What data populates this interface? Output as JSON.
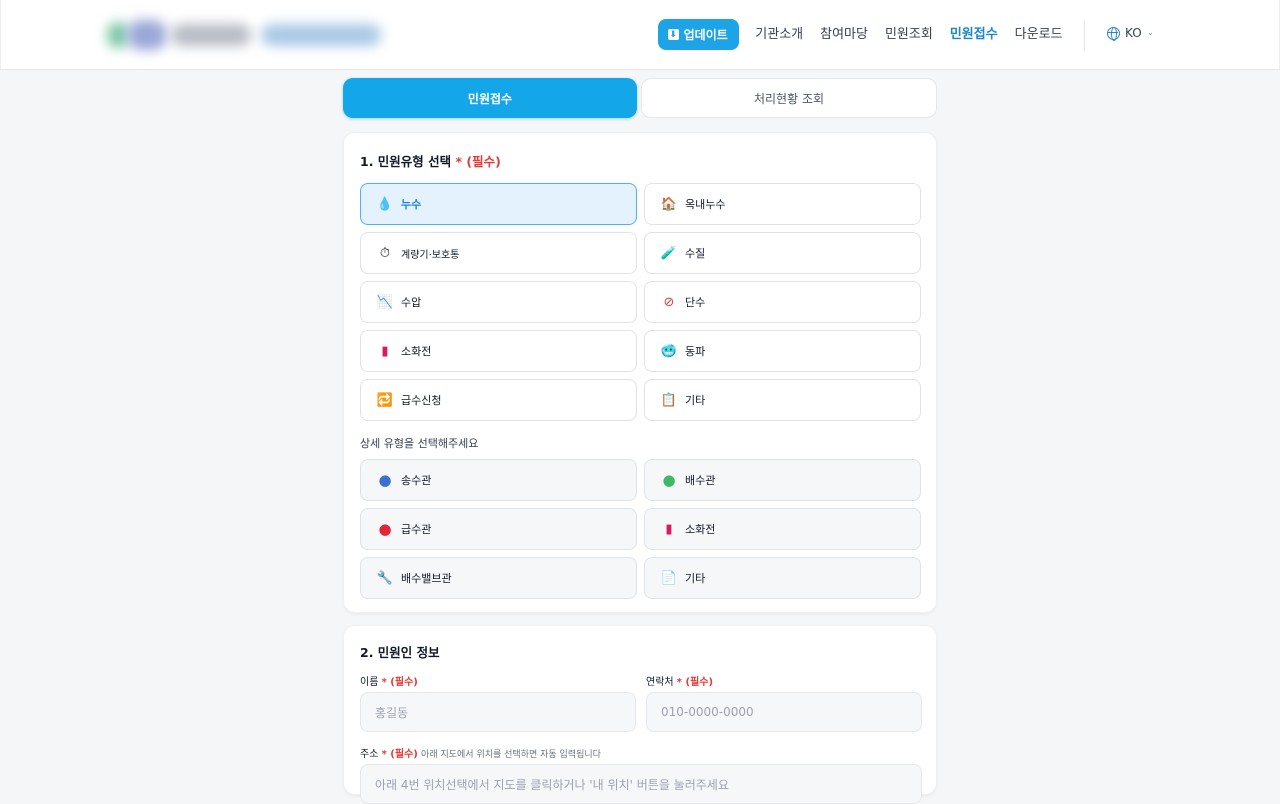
{
  "header": {
    "update_label": "업데이트",
    "nav": [
      "기관소개",
      "참여마당",
      "민원조회",
      "민원접수",
      "다운로드"
    ],
    "active_nav": "민원접수",
    "lang": "KO"
  },
  "tabs": [
    "민원접수",
    "처리현황 조회"
  ],
  "section1": {
    "title": "1. 민원유형 선택",
    "required": "* (필수)",
    "options": [
      {
        "label": "누수",
        "icon": "water-drop-icon"
      },
      {
        "label": "옥내누수",
        "icon": "house-icon"
      },
      {
        "label": "계량기·보호통",
        "icon": "stopwatch-icon"
      },
      {
        "label": "수질",
        "icon": "test-tube-icon"
      },
      {
        "label": "수압",
        "icon": "chart-down-icon"
      },
      {
        "label": "단수",
        "icon": "prohibited-icon"
      },
      {
        "label": "소화전",
        "icon": "fire-hydrant-icon"
      },
      {
        "label": "동파",
        "icon": "cold-face-icon"
      },
      {
        "label": "급수신청",
        "icon": "repeat-arrows-icon"
      },
      {
        "label": "기타",
        "icon": "clipboard-icon"
      }
    ],
    "selected": "누수",
    "sub_title": "상세 유형을 선택해주세요",
    "sub_options": [
      {
        "label": "송수관",
        "icon": "blue-circle-icon"
      },
      {
        "label": "배수관",
        "icon": "green-circle-icon"
      },
      {
        "label": "급수관",
        "icon": "red-circle-icon"
      },
      {
        "label": "소화전",
        "icon": "fire-hydrant-icon"
      },
      {
        "label": "배수밸브관",
        "icon": "wrench-icon"
      },
      {
        "label": "기타",
        "icon": "document-icon"
      }
    ]
  },
  "section2": {
    "title": "2. 민원인 정보",
    "name_label": "이름",
    "name_placeholder": "홍길동",
    "phone_label": "연락처",
    "phone_placeholder": "010-0000-0000",
    "address_label": "주소",
    "address_hint": "아래 지도에서 위치를 선택하면 자동 입력됩니다",
    "address_placeholder": "아래 4번 위치선택에서 지도를 클릭하거나 '내 위치' 버튼을 눌러주세요",
    "required": "* (필수)"
  }
}
